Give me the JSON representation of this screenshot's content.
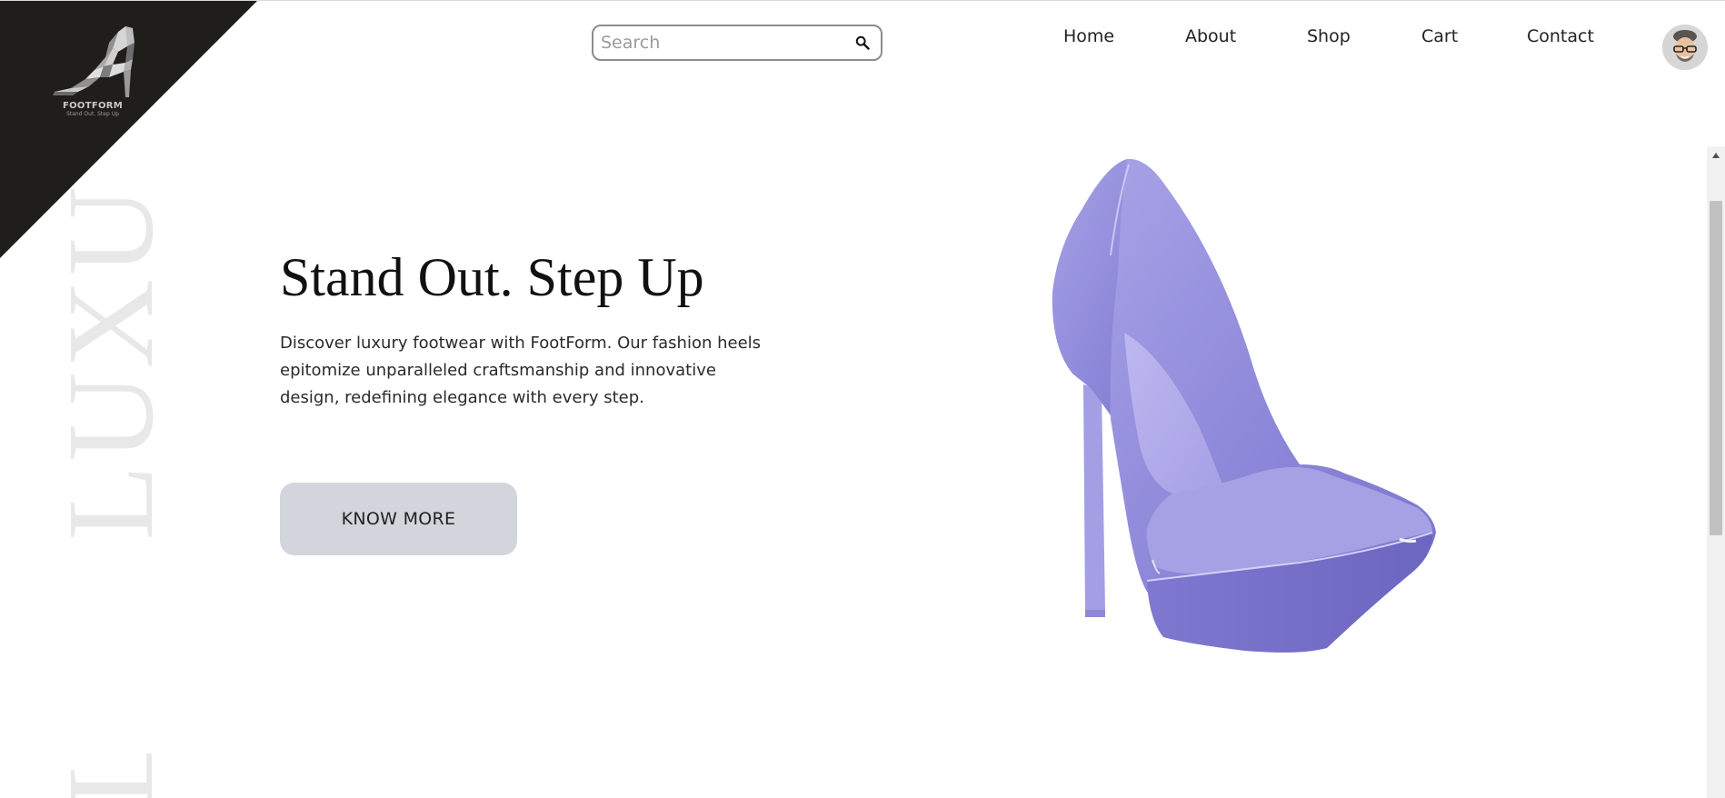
{
  "brand": {
    "name": "FOOTFORM",
    "tagline": "Stand Out. Step Up",
    "corner_color": "#201e1b"
  },
  "search": {
    "placeholder": "Search",
    "icon": "search-icon"
  },
  "nav": {
    "items": [
      {
        "label": "Home"
      },
      {
        "label": "About"
      },
      {
        "label": "Shop"
      },
      {
        "label": "Cart"
      },
      {
        "label": "Contact"
      }
    ]
  },
  "user": {
    "avatar_icon": "user-avatar"
  },
  "decor": {
    "watermark": "LUXU",
    "watermark_bottom": "L"
  },
  "hero": {
    "title": "Stand Out. Step Up",
    "description": "Discover luxury footwear with FootForm. Our fashion heels epitomize unparalleled craftsmanship and innovative design, redefining elegance with every step.",
    "cta_label": "KNOW MORE",
    "cta_color": "#d2d5dc",
    "product_color": "#8b85d6"
  }
}
